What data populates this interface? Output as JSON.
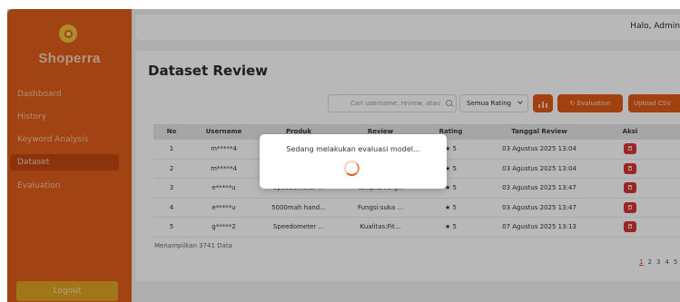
{
  "sidebar": {
    "brand": "Shoperra",
    "items": [
      {
        "label": "Dashboard",
        "active": false
      },
      {
        "label": "History",
        "active": false
      },
      {
        "label": "Keyword Analysis",
        "active": false
      },
      {
        "label": "Dataset",
        "active": true
      },
      {
        "label": "Evaluation",
        "active": false
      }
    ],
    "logout_label": "Logout"
  },
  "header": {
    "greeting": "Halo, Admin"
  },
  "main": {
    "title": "Dataset Review",
    "search_placeholder": "Cari username, review, atau",
    "rating_filter": "Semua Rating",
    "evaluation_label": "Evaluation",
    "upload_label": "Upload CSV",
    "table": {
      "columns": [
        "No",
        "Username",
        "Produk",
        "Review",
        "Rating",
        "Tanggal Review",
        "Aksi"
      ],
      "rows": [
        {
          "no": "1",
          "username": "m*****4",
          "produk": "",
          "review": "",
          "rating": "★ 5",
          "tanggal": "03 Agustus 2025 13:04"
        },
        {
          "no": "2",
          "username": "m*****4",
          "produk": "",
          "review": "",
          "rating": "★ 5",
          "tanggal": "03 Agustus 2025 13:04"
        },
        {
          "no": "3",
          "username": "e*****u",
          "produk": "Speedometer ...",
          "review": "Tampilan:org...",
          "rating": "★ 5",
          "tanggal": "03 Agustus 2025 13:47"
        },
        {
          "no": "4",
          "username": "e*****u",
          "produk": "5000mah hand...",
          "review": "Fungsi:suka ...",
          "rating": "★ 5",
          "tanggal": "03 Agustus 2025 13:47"
        },
        {
          "no": "5",
          "username": "g*****2",
          "produk": "Speedometer ...",
          "review": "Kualitas:Fit...",
          "rating": "★ 5",
          "tanggal": "07 Agustus 2025 13:13"
        }
      ]
    },
    "footer_text": "Menampilkan 3741 Data",
    "pagination": [
      "1",
      "2",
      "3",
      "4",
      "5",
      "...",
      "›"
    ],
    "current_page": "1"
  },
  "modal": {
    "message": "Sedang melakukan evaluasi model..."
  },
  "colors": {
    "accent": "#e05a17",
    "sidebar": "#df5d1a",
    "logout": "#e0a425",
    "delete": "#d93535"
  }
}
